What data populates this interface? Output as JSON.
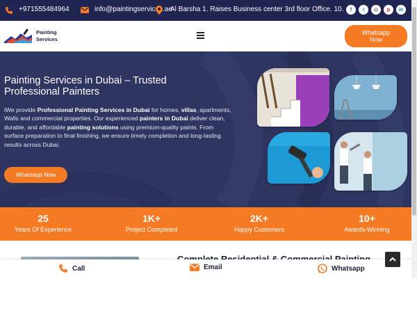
{
  "topbar": {
    "phone": "+971555484964",
    "email": "info@paintingservices.ae",
    "address": "Al Barsha 1. Raises Business center 3rd floor Office. 10.",
    "socials": [
      {
        "name": "facebook",
        "glyph": "f",
        "color": "#3b5998"
      },
      {
        "name": "twitter",
        "glyph": "t",
        "color": "#1da1f2"
      },
      {
        "name": "instagram",
        "glyph": "◎",
        "color": "#262626"
      },
      {
        "name": "pinterest",
        "glyph": "p",
        "color": "#cb2027"
      },
      {
        "name": "linkedin",
        "glyph": "in",
        "color": "#0077b5"
      }
    ]
  },
  "header": {
    "logo_line1": "Painting",
    "logo_line2": "Services",
    "whatsapp_line1": "Whatsapp",
    "whatsapp_line2": "Now"
  },
  "hero": {
    "title": "Painting Services in Dubai – Trusted Professional Painters",
    "p1": "iWe provide ",
    "b1": "Professional Painting Services in Dubai",
    "p2": " for homes, ",
    "b2": "villas",
    "p3": ", apartments, Walls and commercial properties. Our experienced ",
    "b3": "painters in Dubai",
    "p4": " deliver clean, durable, and affordable ",
    "b4": "painting solutions",
    "p5": " using premium-quality paints. From surface preparation to final finishing, we ensure timely completion and long-lasting results across Dubai.",
    "button": "Whatsapp Now"
  },
  "stats": [
    {
      "number": "25",
      "label": "Years Of Experience"
    },
    {
      "number": "1K+",
      "label": "Project Completed"
    },
    {
      "number": "2K+",
      "label": "Happy Customers"
    },
    {
      "number": "10+",
      "label": "Awards-Winning"
    }
  ],
  "section_title": "Complete Residential & Commercial Painting",
  "bottom_bar": {
    "call": "Call",
    "email": "Email",
    "whatsapp": "Whatsapp"
  },
  "colors": {
    "accent": "#f47a24",
    "navy": "#1f2550",
    "hero_bg": "#2e3560"
  }
}
